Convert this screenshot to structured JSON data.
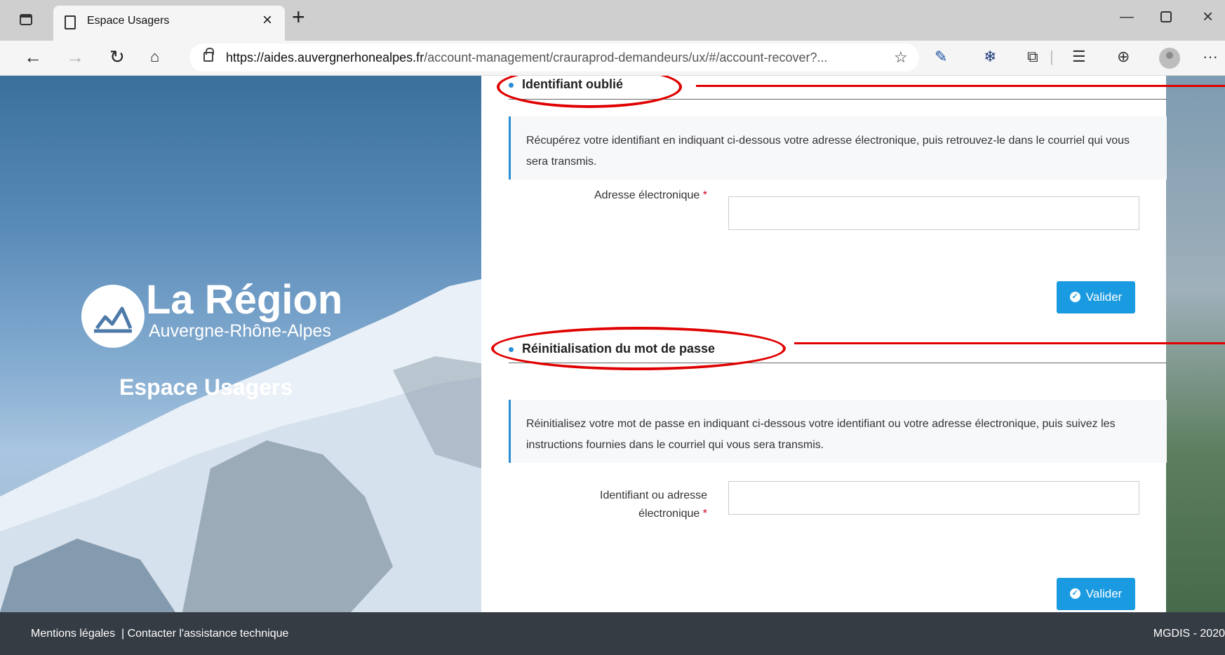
{
  "browser": {
    "tab_title": "Espace Usagers",
    "url_host": "https://aides.auvergnerhonealpes.fr",
    "url_path": "/account-management/crauraprod-demandeurs/ux/#/account-recover?...",
    "icons": [
      "tab-actions-icon",
      "page-icon",
      "close-icon",
      "plus-icon",
      "back-icon",
      "forward-icon",
      "refresh-icon",
      "home-icon",
      "lock-icon",
      "add-favorite-icon",
      "pen-extension-icon",
      "snowflake-extension-icon",
      "extensions-icon",
      "favorites-icon",
      "collections-icon",
      "profile-icon",
      "more-icon",
      "minimize-icon",
      "maximize-icon",
      "close-window-icon"
    ]
  },
  "hero": {
    "logo_title": "La Région",
    "logo_subtitle": "Auvergne-Rhône-Alpes",
    "space_title": "Espace Usagers"
  },
  "forgot_id": {
    "title": "Identifiant oublié",
    "info": "Récupérez votre identifiant en indiquant ci-dessous votre adresse électronique, puis retrouvez-le dans le courriel qui vous sera transmis.",
    "field_label": "Adresse électronique",
    "required_mark": "*",
    "input_value": "",
    "submit_label": "Valider"
  },
  "reset_pwd": {
    "title": "Réinitialisation du mot de passe",
    "info": "Réinitialisez votre mot de passe en indiquant ci-dessous votre identifiant ou votre adresse électronique, puis suivez les instructions fournies dans le courriel qui vous sera transmis.",
    "field_label_line1": "Identifiant ou adresse",
    "field_label_line2": "électronique",
    "required_mark": "*",
    "input_value": "",
    "submit_label": "Valider"
  },
  "footer": {
    "legal": "Mentions légales",
    "separator": "|",
    "support": "Contacter l'assistance technique",
    "copyright": "MGDIS - 2020"
  },
  "colors": {
    "accent": "#1a9ae0",
    "annotation": "#e00000",
    "footer_bg": "#363c44"
  }
}
